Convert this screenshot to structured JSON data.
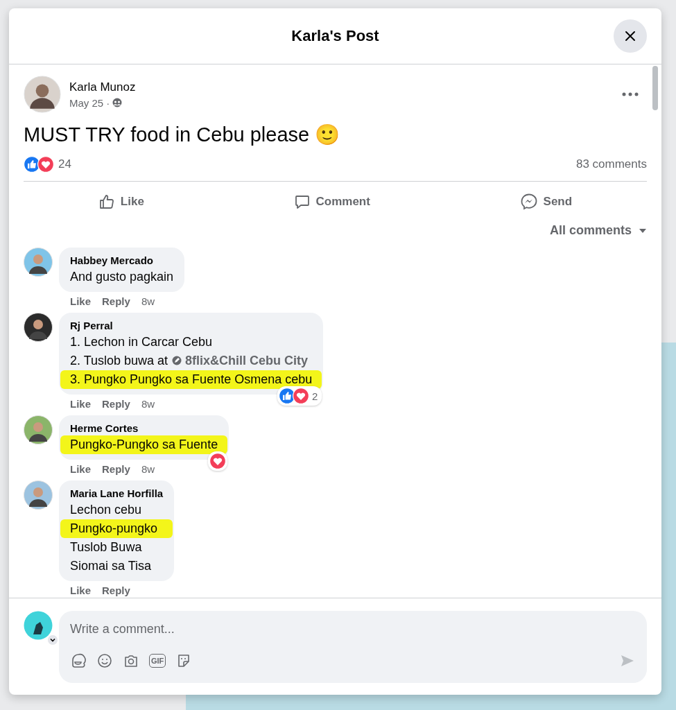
{
  "dialog": {
    "title": "Karla's Post"
  },
  "post": {
    "author": "Karla Munoz",
    "date": "May 25",
    "separator": "·",
    "text": "MUST TRY food in Cebu please",
    "emoji": "🙂",
    "reactions": [
      {
        "kind": "like"
      },
      {
        "kind": "love"
      }
    ],
    "reaction_count": "24",
    "comment_count": "83 comments"
  },
  "actions": [
    {
      "kind": "like",
      "label": "Like"
    },
    {
      "kind": "comment",
      "label": "Comment"
    },
    {
      "kind": "send",
      "label": "Send"
    }
  ],
  "sort": {
    "label": "All comments"
  },
  "comments": [
    {
      "author": "Habbey Mercado",
      "lines": [
        {
          "text": "And gusto pagkain",
          "highlighted": false
        }
      ],
      "like": "Like",
      "reply": "Reply",
      "time": "8w"
    },
    {
      "author": "Rj Perral",
      "lines": [
        {
          "text": "1. Lechon in Carcar Cebu",
          "highlighted": false
        },
        {
          "text": "2. Tuslob buwa at",
          "tag": "8flix&Chill Cebu City",
          "highlighted": false
        },
        {
          "text": "3. Pungko Pungko sa Fuente Osmena cebu",
          "highlighted": true
        }
      ],
      "like": "Like",
      "reply": "Reply",
      "time": "8w",
      "reactions": [
        {
          "kind": "like"
        },
        {
          "kind": "love"
        }
      ],
      "reaction_count": "2"
    },
    {
      "author": "Herme Cortes",
      "lines": [
        {
          "text": "Pungko-Pungko sa Fuente",
          "highlighted": true
        }
      ],
      "like": "Like",
      "reply": "Reply",
      "time": "8w",
      "reactions": [
        {
          "kind": "love"
        }
      ]
    },
    {
      "author": "Maria Lane Horfilla",
      "lines": [
        {
          "text": "Lechon cebu",
          "highlighted": false
        },
        {
          "text": "Pungko-pungko",
          "highlighted": true
        },
        {
          "text": "Tuslob Buwa",
          "highlighted": false
        },
        {
          "text": "Siomai sa Tisa",
          "highlighted": false
        }
      ],
      "like": "Like",
      "reply": "Reply"
    }
  ],
  "composer": {
    "placeholder": "Write a comment...",
    "tools": [
      {
        "kind": "avatar"
      },
      {
        "kind": "emoji"
      },
      {
        "kind": "camera"
      },
      {
        "kind": "gif"
      },
      {
        "kind": "sticker"
      }
    ],
    "gif_label": "GIF"
  }
}
